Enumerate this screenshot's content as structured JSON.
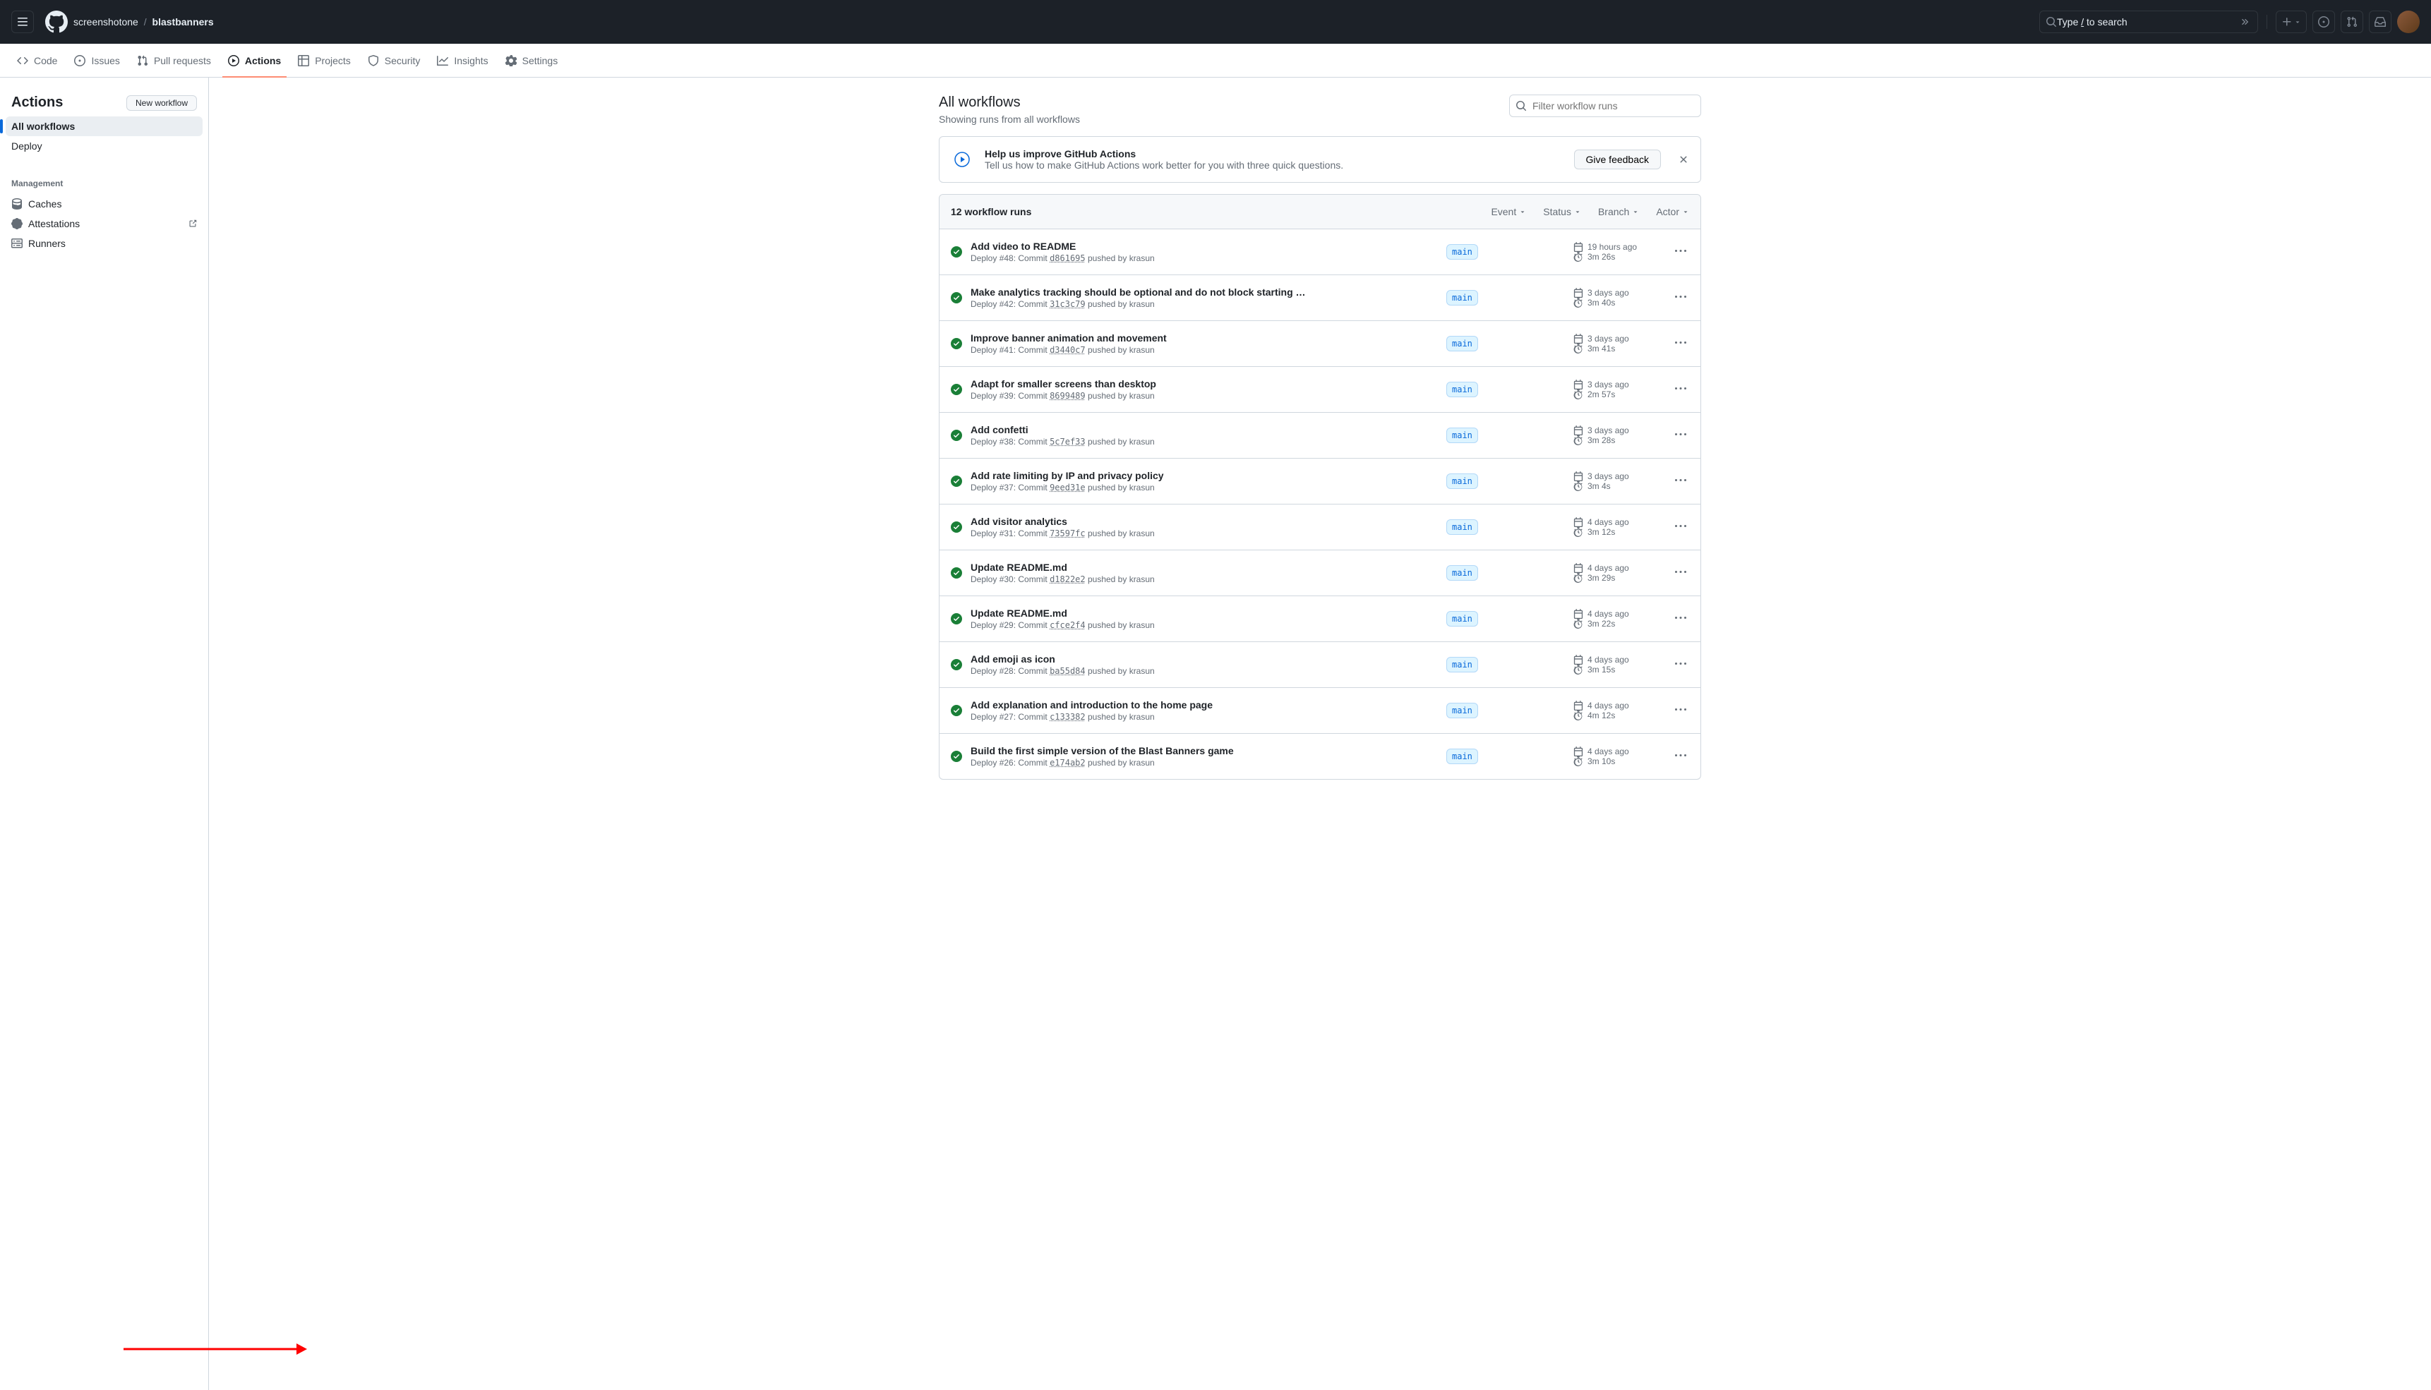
{
  "breadcrumb": {
    "org": "screenshotone",
    "repo": "blastbanners"
  },
  "search": {
    "text": "Type ",
    "slash": "/",
    "text2": " to search"
  },
  "nav": {
    "code": "Code",
    "issues": "Issues",
    "pulls": "Pull requests",
    "actions": "Actions",
    "projects": "Projects",
    "security": "Security",
    "insights": "Insights",
    "settings": "Settings"
  },
  "sidebar": {
    "title": "Actions",
    "new_workflow": "New workflow",
    "all_workflows": "All workflows",
    "deploy": "Deploy",
    "management": "Management",
    "caches": "Caches",
    "attestations": "Attestations",
    "runners": "Runners"
  },
  "content": {
    "title": "All workflows",
    "subtitle": "Showing runs from all workflows",
    "filter_placeholder": "Filter workflow runs"
  },
  "feedback": {
    "title": "Help us improve GitHub Actions",
    "text": "Tell us how to make GitHub Actions work better for you with three quick questions.",
    "button": "Give feedback"
  },
  "runs_header": {
    "count": "12 workflow runs",
    "event": "Event",
    "status": "Status",
    "branch": "Branch",
    "actor": "Actor"
  },
  "runs": [
    {
      "title": "Add video to README",
      "num": "#48",
      "sha": "d861695",
      "user": "krasun",
      "branch": "main",
      "date": "19 hours ago",
      "duration": "3m 26s"
    },
    {
      "title": "Make analytics tracking should be optional and do not block starting …",
      "num": "#42",
      "sha": "31c3c79",
      "user": "krasun",
      "branch": "main",
      "date": "3 days ago",
      "duration": "3m 40s"
    },
    {
      "title": "Improve banner animation and movement",
      "num": "#41",
      "sha": "d3440c7",
      "user": "krasun",
      "branch": "main",
      "date": "3 days ago",
      "duration": "3m 41s"
    },
    {
      "title": "Adapt for smaller screens than desktop",
      "num": "#39",
      "sha": "8699489",
      "user": "krasun",
      "branch": "main",
      "date": "3 days ago",
      "duration": "2m 57s"
    },
    {
      "title": "Add confetti",
      "num": "#38",
      "sha": "5c7ef33",
      "user": "krasun",
      "branch": "main",
      "date": "3 days ago",
      "duration": "3m 28s"
    },
    {
      "title": "Add rate limiting by IP and privacy policy",
      "num": "#37",
      "sha": "9eed31e",
      "user": "krasun",
      "branch": "main",
      "date": "3 days ago",
      "duration": "3m 4s"
    },
    {
      "title": "Add visitor analytics",
      "num": "#31",
      "sha": "73597fc",
      "user": "krasun",
      "branch": "main",
      "date": "4 days ago",
      "duration": "3m 12s"
    },
    {
      "title": "Update README.md",
      "num": "#30",
      "sha": "d1822e2",
      "user": "krasun",
      "branch": "main",
      "date": "4 days ago",
      "duration": "3m 29s"
    },
    {
      "title": "Update README.md",
      "num": "#29",
      "sha": "cfce2f4",
      "user": "krasun",
      "branch": "main",
      "date": "4 days ago",
      "duration": "3m 22s"
    },
    {
      "title": "Add emoji as icon",
      "num": "#28",
      "sha": "ba55d84",
      "user": "krasun",
      "branch": "main",
      "date": "4 days ago",
      "duration": "3m 15s"
    },
    {
      "title": "Add explanation and introduction to the home page",
      "num": "#27",
      "sha": "c133382",
      "user": "krasun",
      "branch": "main",
      "date": "4 days ago",
      "duration": "4m 12s"
    },
    {
      "title": "Build the first simple version of the Blast Banners game",
      "num": "#26",
      "sha": "e174ab2",
      "user": "krasun",
      "branch": "main",
      "date": "4 days ago",
      "duration": "3m 10s"
    }
  ],
  "labels": {
    "deploy": "Deploy",
    "commit": "Commit",
    "pushed_by": "pushed by"
  }
}
